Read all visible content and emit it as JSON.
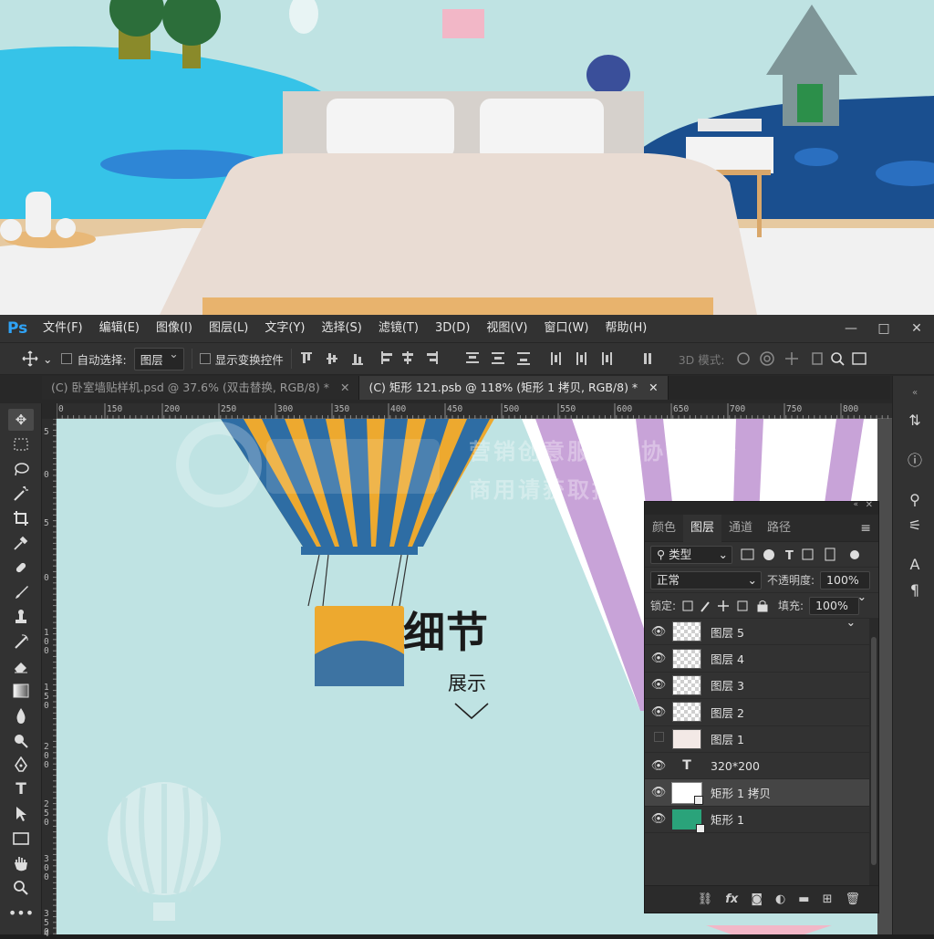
{
  "app": {
    "logo": "Ps"
  },
  "menu": [
    "文件(F)",
    "编辑(E)",
    "图像(I)",
    "图层(L)",
    "文字(Y)",
    "选择(S)",
    "滤镜(T)",
    "3D(D)",
    "视图(V)",
    "窗口(W)",
    "帮助(H)"
  ],
  "window_controls": {
    "minimize": "—",
    "maximize": "□",
    "close": "✕"
  },
  "options": {
    "auto_select_label": "自动选择:",
    "auto_select_value": "图层",
    "show_transform_label": "显示变换控件",
    "mode_3d_label": "3D 模式:"
  },
  "tabs": [
    {
      "label": "(C) 卧室墙贴样机.psd @ 37.6% (双击替换, RGB/8) *",
      "close": "✕",
      "active": false
    },
    {
      "label": "(C) 矩形 121.psb @ 118% (矩形 1 拷贝, RGB/8) *",
      "close": "✕",
      "active": true
    }
  ],
  "ruler": {
    "top": [
      "0",
      "150",
      "200",
      "250",
      "300",
      "350",
      "400",
      "450",
      "500",
      "550",
      "600",
      "650",
      "700",
      "750",
      "800"
    ],
    "left": [
      "5",
      "0",
      "5",
      "0",
      "1 0 0",
      "1 5 0",
      "2 0 0",
      "2 5 0",
      "3 0 0",
      "3 5 0",
      "4"
    ]
  },
  "artwork": {
    "title": "细节",
    "subtitle": "展示",
    "watermark_line1": "营销创意服务与协作平台",
    "watermark_line2": "商用请获取授权"
  },
  "layers_panel": {
    "tabs": [
      "颜色",
      "图层",
      "通道",
      "路径"
    ],
    "active_tab": "图层",
    "filter_label": "类型",
    "blend_mode": "正常",
    "opacity_label": "不透明度:",
    "opacity_value": "100%",
    "lock_label": "锁定:",
    "fill_label": "填充:",
    "fill_value": "100%",
    "layers": [
      {
        "name": "图层 5",
        "type": "pixel",
        "visible": true
      },
      {
        "name": "图层 4",
        "type": "pixel",
        "visible": true
      },
      {
        "name": "图层 3",
        "type": "pixel",
        "visible": true
      },
      {
        "name": "图层 2",
        "type": "pixel",
        "visible": true
      },
      {
        "name": "图层 1",
        "type": "pixel",
        "visible": false
      },
      {
        "name": "320*200",
        "type": "text",
        "visible": true
      },
      {
        "name": "矩形 1 拷贝",
        "type": "shape",
        "visible": true,
        "selected": true,
        "color": "#ffffff"
      },
      {
        "name": "矩形 1",
        "type": "shape",
        "visible": true,
        "color": "#2aa37a"
      }
    ],
    "footer_icons": [
      "link-icon",
      "fx-icon",
      "mask-icon",
      "adjustment-icon",
      "folder-icon",
      "new-layer-icon",
      "trash-icon"
    ]
  },
  "colors": {
    "accent_ps": "#2fa3f6",
    "canvas_bg": "#bfe3e3",
    "balloon_blue": "#2e6da4",
    "balloon_orange": "#eda92f",
    "balloon_purple": "#c8a3d8"
  }
}
